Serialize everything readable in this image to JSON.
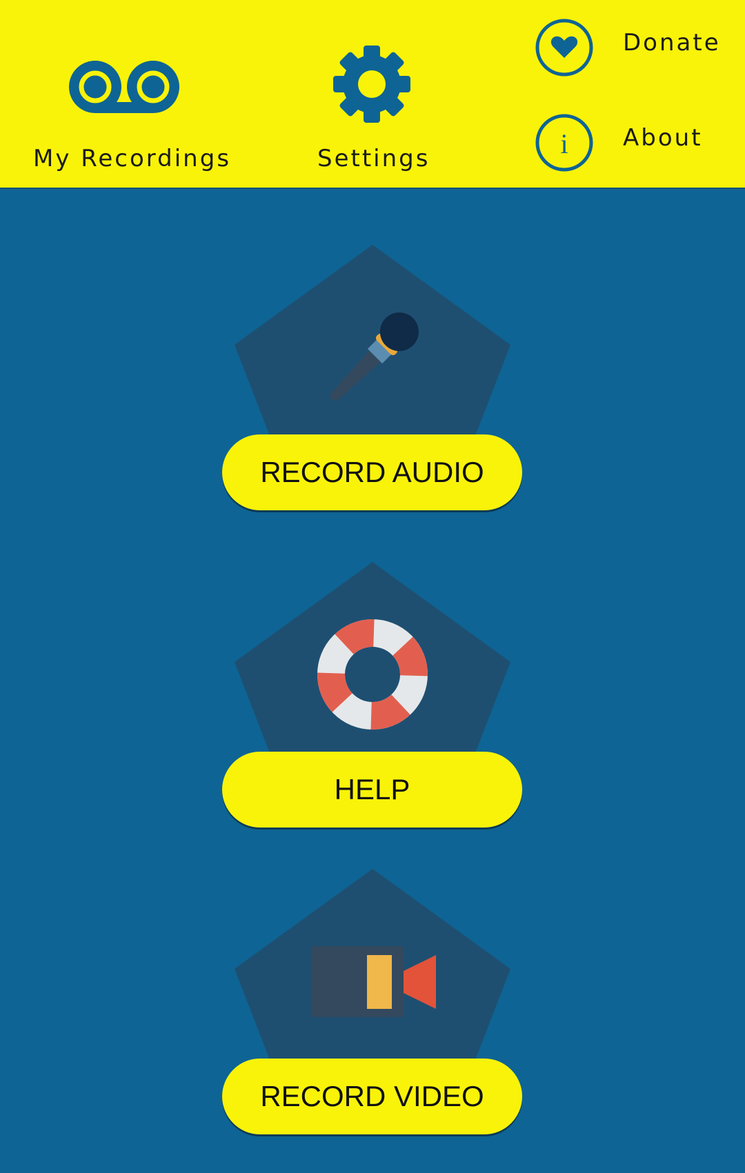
{
  "colors": {
    "background": "#0e6494",
    "topbar": "#f9f30a",
    "pentagon": "#1e4f71",
    "button": "#f9f30a",
    "icon": "#0e6494"
  },
  "nav": {
    "recordings": {
      "label": "My Recordings",
      "icon": "voicemail-icon"
    },
    "settings": {
      "label": "Settings",
      "icon": "gear-icon"
    },
    "donate": {
      "label": "Donate",
      "icon": "heart-icon"
    },
    "about": {
      "label": "About",
      "icon": "info-icon"
    }
  },
  "actions": [
    {
      "label": "RECORD AUDIO",
      "icon": "microphone-icon"
    },
    {
      "label": "HELP",
      "icon": "lifebuoy-icon"
    },
    {
      "label": "RECORD VIDEO",
      "icon": "video-camera-icon"
    }
  ]
}
